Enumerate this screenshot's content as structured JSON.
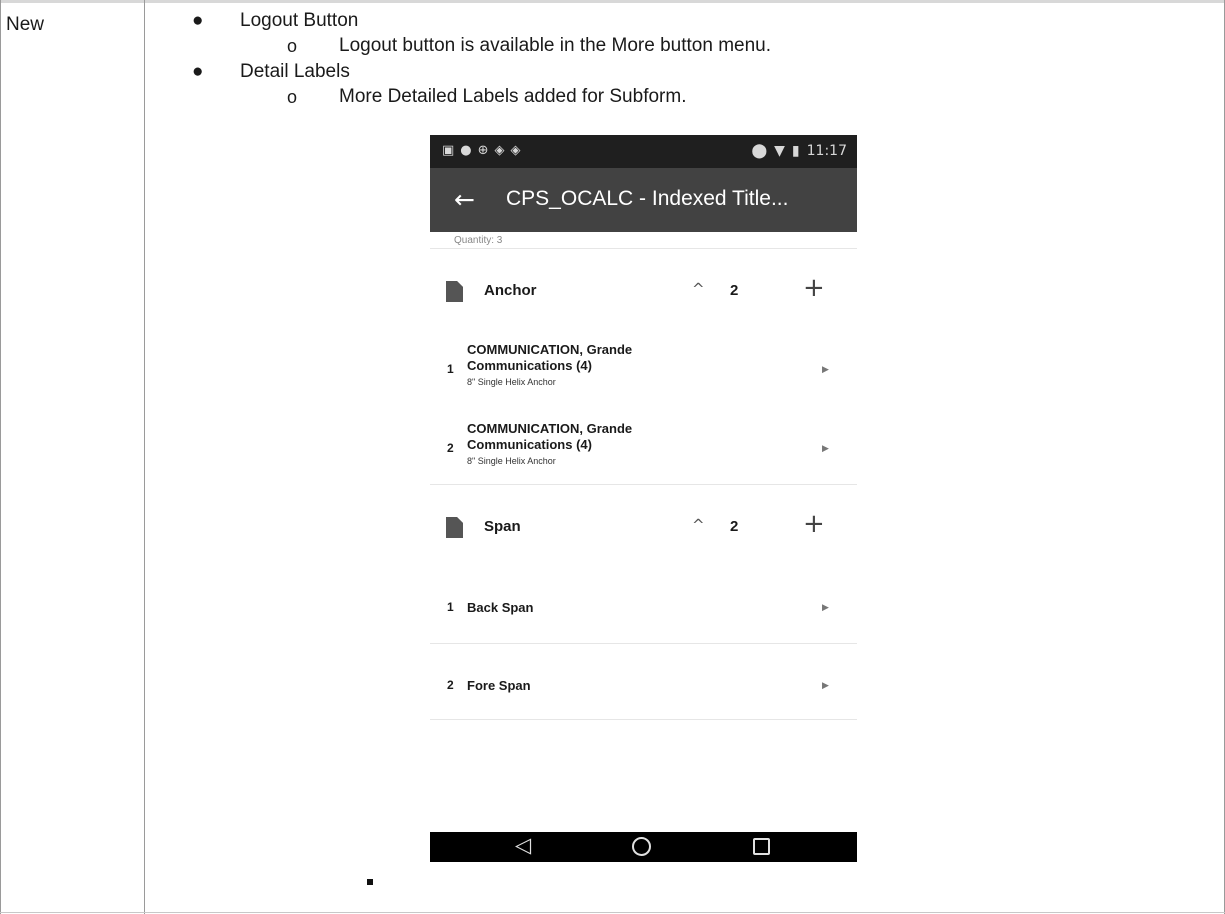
{
  "row": {
    "label": "New"
  },
  "items": [
    {
      "title": "Logout Button",
      "detail": "Logout button is available in the More button menu."
    },
    {
      "title": "Detail Labels",
      "detail": "More Detailed Labels added for Subform."
    }
  ],
  "bullets": {
    "level1": "●",
    "level2": "o"
  },
  "phone": {
    "status_bar": {
      "time": "11:17",
      "left_icons": [
        "image-icon",
        "shield-icon",
        "globe-icon",
        "crosshair-icon",
        "gps-icon"
      ],
      "right_icons": [
        "location-pin-icon",
        "wifi-icon",
        "battery-icon"
      ]
    },
    "app_bar": {
      "back_icon": "←",
      "title": "CPS_OCALC - Indexed Title..."
    },
    "quantity_text": "Quantity: 3",
    "sections": [
      {
        "title": "Anchor",
        "count": "2",
        "chevron": "^",
        "plus": "+",
        "records": [
          {
            "index": "1",
            "title_line1": "COMMUNICATION, Grande",
            "title_line2": "Communications (4)",
            "subtitle": "8\" Single Helix Anchor"
          },
          {
            "index": "2",
            "title_line1": "COMMUNICATION, Grande",
            "title_line2": "Communications (4)",
            "subtitle": "8\" Single Helix Anchor"
          }
        ]
      },
      {
        "title": "Span",
        "count": "2",
        "chevron": "^",
        "plus": "+",
        "records": [
          {
            "index": "1",
            "title": "Back Span"
          },
          {
            "index": "2",
            "title": "Fore Span"
          }
        ]
      }
    ],
    "arrow_glyph": "▶",
    "nav": {
      "back": "◁",
      "home": "home-circle-icon",
      "recents": "recents-square-icon"
    }
  }
}
